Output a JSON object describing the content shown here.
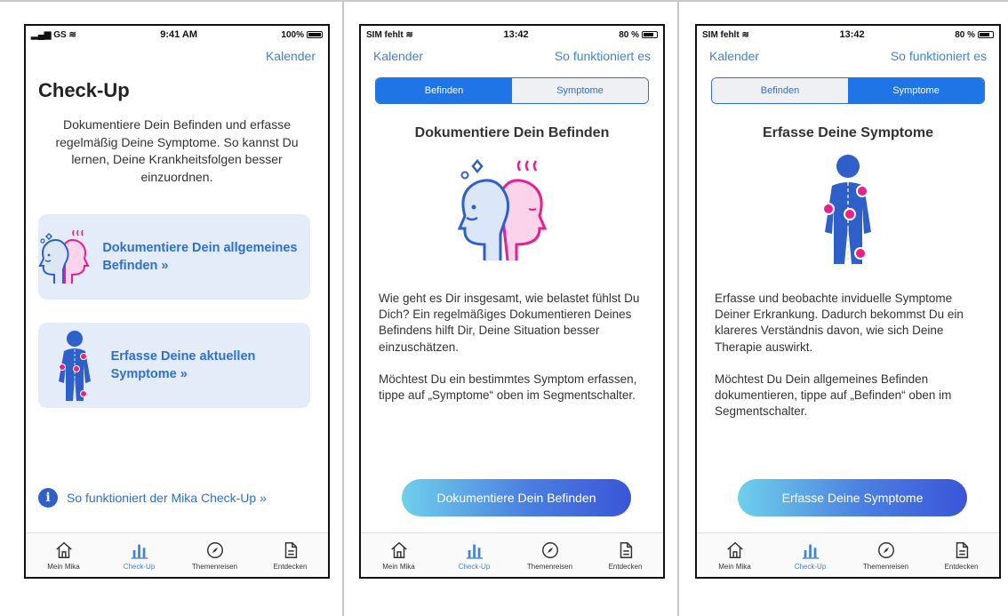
{
  "colors": {
    "accent": "#2f6fd8",
    "magenta": "#e8208f",
    "card": "#e3ecf8"
  },
  "tabs": [
    {
      "label": "Mein Mika",
      "icon": "house-icon"
    },
    {
      "label": "Check-Up",
      "icon": "bar-chart-icon"
    },
    {
      "label": "Themenreisen",
      "icon": "compass-icon"
    },
    {
      "label": "Entdecken",
      "icon": "document-icon"
    }
  ],
  "screen1": {
    "status": {
      "left": "GS",
      "time": "9:41 AM",
      "battery": "100%"
    },
    "nav_right": "Kalender",
    "title": "Check-Up",
    "intro": "Dokumentiere Dein Befinden und erfasse regelmäßig Deine Symptome. So kannst Du lernen, Deine Krankheitsfolgen besser einzuordnen.",
    "card1_label": "Dokumentiere Dein allgemeines Befinden »",
    "card2_label": "Erfasse Deine aktuellen Symptome »",
    "info_link": "So funktioniert der Mika Check-Up »"
  },
  "screen2": {
    "status": {
      "left": "SIM fehlt",
      "time": "13:42",
      "battery": "80 %"
    },
    "nav_left": "Kalender",
    "nav_right": "So funktioniert es",
    "seg_left": "Befinden",
    "seg_right": "Symptome",
    "title": "Dokumentiere Dein Befinden",
    "para1": "Wie geht es Dir insgesamt, wie belastet fühlst Du Dich? Ein regelmäßiges Dokumentieren Deines Befindens hilft Dir, Deine Situation besser einzuschätzen.",
    "para2": "Möchtest Du ein bestimmtes Symptom erfassen, tippe auf „Symptome“ oben im Segmentschalter.",
    "cta": "Dokumentiere Dein Befinden"
  },
  "screen3": {
    "status": {
      "left": "SIM fehlt",
      "time": "13:42",
      "battery": "80 %"
    },
    "nav_left": "Kalender",
    "nav_right": "So funktioniert es",
    "seg_left": "Befinden",
    "seg_right": "Symptome",
    "title": "Erfasse Deine Symptome",
    "para1": "Erfasse und beobachte inviduelle Symptome Deiner Erkrankung. Dadurch bekommst Du ein klareres Verständnis davon, wie sich Deine Therapie auswirkt.",
    "para2": "Möchtest Du Dein allgemeines Befinden dokumentieren, tippe auf „Befinden“ oben im Segmentschalter.",
    "cta": "Erfasse Deine Symptome"
  }
}
